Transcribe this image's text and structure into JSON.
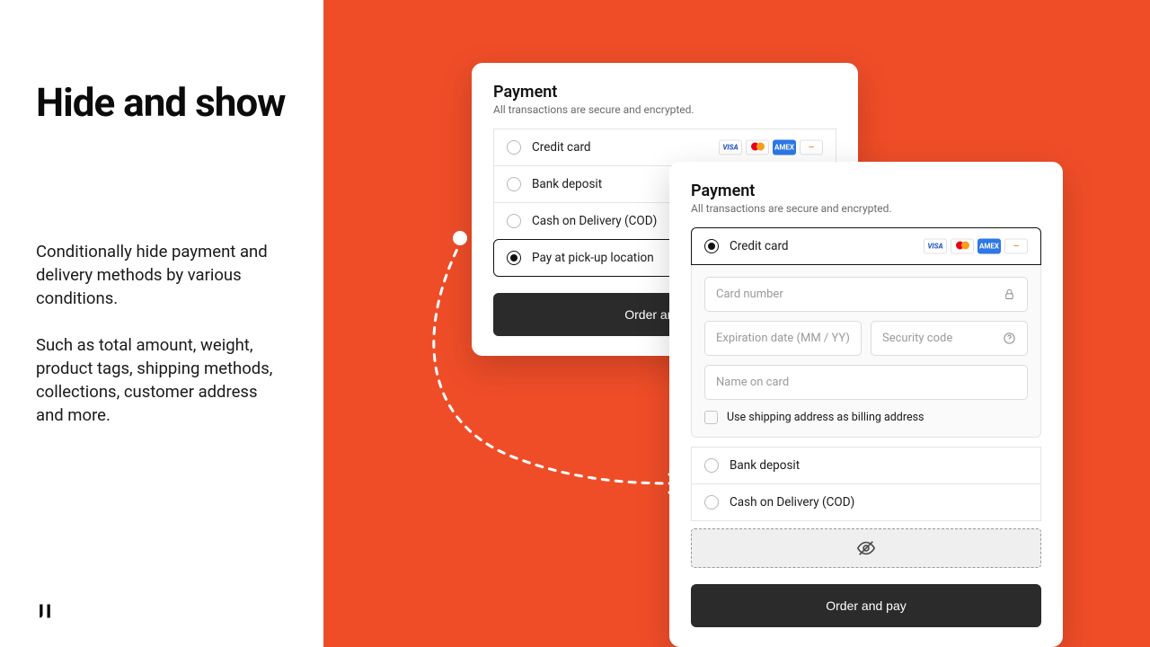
{
  "hero": {
    "title": "Hide and show",
    "body": "Conditionally hide payment and delivery methods by various conditions.\n\nSuch as total amount, weight, product tags, shipping methods, collections, customer address and more."
  },
  "card_a": {
    "title": "Payment",
    "subtitle": "All transactions are secure and encrypted.",
    "options": [
      "Credit card",
      "Bank deposit",
      "Cash on Delivery (COD)",
      "Pay at pick-up location"
    ],
    "cta": "Order and pay"
  },
  "card_b": {
    "title": "Payment",
    "subtitle": "All transactions are secure and encrypted.",
    "cc_label": "Credit card",
    "fields": {
      "card_number": "Card number",
      "expiration": "Expiration date (MM / YY)",
      "security": "Security code",
      "name": "Name on card"
    },
    "checkbox_label": "Use shipping address as billing address",
    "options": [
      "Bank deposit",
      "Cash on Delivery (COD)"
    ],
    "cta": "Order and pay"
  },
  "icons": {
    "visa": "VISA",
    "amex": "AMEX",
    "disc": "—"
  }
}
